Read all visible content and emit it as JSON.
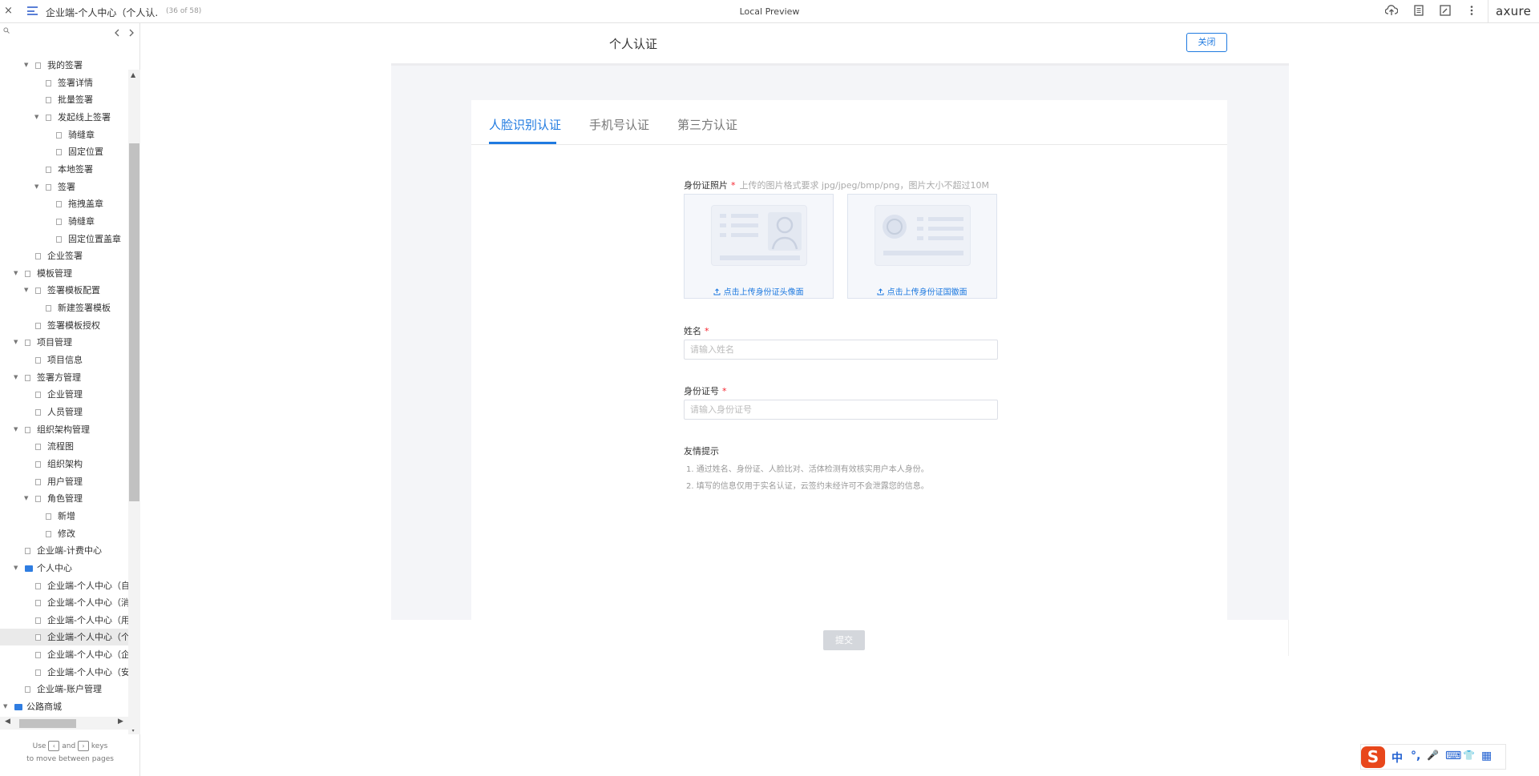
{
  "topbar": {
    "close": "×",
    "page_title": "企业端-个人中心（个人认...",
    "page_count": "(36 of 58)",
    "center_title": "Local Preview",
    "logo": "axure"
  },
  "sidebar": {
    "tree": [
      {
        "label": "我的签署",
        "level": 2,
        "expand": "▼",
        "type": "page"
      },
      {
        "label": "签署详情",
        "level": 3,
        "expand": "",
        "type": "page"
      },
      {
        "label": "批量签署",
        "level": 3,
        "expand": "",
        "type": "page"
      },
      {
        "label": "发起线上签署",
        "level": 3,
        "expand": "▼",
        "type": "page"
      },
      {
        "label": "骑缝章",
        "level": 4,
        "expand": "",
        "type": "page"
      },
      {
        "label": "固定位置",
        "level": 4,
        "expand": "",
        "type": "page"
      },
      {
        "label": "本地签署",
        "level": 3,
        "expand": "",
        "type": "page"
      },
      {
        "label": "签署",
        "level": 3,
        "expand": "▼",
        "type": "page"
      },
      {
        "label": "拖拽盖章",
        "level": 4,
        "expand": "",
        "type": "page"
      },
      {
        "label": "骑缝章",
        "level": 4,
        "expand": "",
        "type": "page"
      },
      {
        "label": "固定位置盖章",
        "level": 4,
        "expand": "",
        "type": "page"
      },
      {
        "label": "企业签署",
        "level": 2,
        "expand": "",
        "type": "page"
      },
      {
        "label": "模板管理",
        "level": 1,
        "expand": "▼",
        "type": "page"
      },
      {
        "label": "签署模板配置",
        "level": 2,
        "expand": "▼",
        "type": "page"
      },
      {
        "label": "新建签署模板",
        "level": 3,
        "expand": "",
        "type": "page"
      },
      {
        "label": "签署模板授权",
        "level": 2,
        "expand": "",
        "type": "page"
      },
      {
        "label": "项目管理",
        "level": 1,
        "expand": "▼",
        "type": "page"
      },
      {
        "label": "项目信息",
        "level": 2,
        "expand": "",
        "type": "page"
      },
      {
        "label": "签署方管理",
        "level": 1,
        "expand": "▼",
        "type": "page"
      },
      {
        "label": "企业管理",
        "level": 2,
        "expand": "",
        "type": "page"
      },
      {
        "label": "人员管理",
        "level": 2,
        "expand": "",
        "type": "page"
      },
      {
        "label": "组织架构管理",
        "level": 1,
        "expand": "▼",
        "type": "page"
      },
      {
        "label": "流程图",
        "level": 2,
        "expand": "",
        "type": "page"
      },
      {
        "label": "组织架构",
        "level": 2,
        "expand": "",
        "type": "page"
      },
      {
        "label": "用户管理",
        "level": 2,
        "expand": "",
        "type": "page"
      },
      {
        "label": "角色管理",
        "level": 2,
        "expand": "▼",
        "type": "page"
      },
      {
        "label": "新增",
        "level": 3,
        "expand": "",
        "type": "page"
      },
      {
        "label": "修改",
        "level": 3,
        "expand": "",
        "type": "page"
      },
      {
        "label": "企业端-计费中心",
        "level": 1,
        "expand": "",
        "type": "page"
      },
      {
        "label": "个人中心",
        "level": 1,
        "expand": "▼",
        "type": "folder"
      },
      {
        "label": "企业端-个人中心（自",
        "level": 2,
        "expand": "",
        "type": "page"
      },
      {
        "label": "企业端-个人中心（消",
        "level": 2,
        "expand": "",
        "type": "page"
      },
      {
        "label": "企业端-个人中心（用",
        "level": 2,
        "expand": "",
        "type": "page"
      },
      {
        "label": "企业端-个人中心（个",
        "level": 2,
        "expand": "",
        "type": "page",
        "selected": true
      },
      {
        "label": "企业端-个人中心（企",
        "level": 2,
        "expand": "",
        "type": "page"
      },
      {
        "label": "企业端-个人中心（安",
        "level": 2,
        "expand": "",
        "type": "page"
      },
      {
        "label": "企业端-账户管理",
        "level": 1,
        "expand": "",
        "type": "page"
      },
      {
        "label": "公路商城",
        "level": 0,
        "expand": "▼",
        "type": "folder"
      }
    ],
    "hint_use": "Use",
    "hint_and": "and",
    "hint_keys": "keys",
    "hint_line2": "to move between pages"
  },
  "page": {
    "title": "个人认证",
    "close_label": "关闭",
    "tabs": [
      "人脸识别认证",
      "手机号认证",
      "第三方认证"
    ],
    "photo_label": "身份证照片",
    "required_mark": "*",
    "photo_hint": "上传的图片格式要求 jpg/jpeg/bmp/png，图片大小不超过10M",
    "upload_front": "点击上传身份证头像面",
    "upload_back": "点击上传身份证国徽面",
    "name_label": "姓名",
    "name_placeholder": "请输入姓名",
    "id_label": "身份证号",
    "id_placeholder": "请输入身份证号",
    "tips_title": "友情提示",
    "tips": [
      "1. 通过姓名、身份证、人脸比对、活体检测有效核实用户本人身份。",
      "2. 填写的信息仅用于实名认证，云签约未经许可不会泄露您的信息。"
    ],
    "submit_label": "提交"
  },
  "ime": {
    "logo": "S",
    "items": [
      "中",
      "°,",
      "🎤",
      "⌨",
      "👕",
      "▦"
    ]
  },
  "colors": {
    "accent": "#1f7ae0",
    "required": "#f5222d",
    "background": "#f4f5f8"
  }
}
